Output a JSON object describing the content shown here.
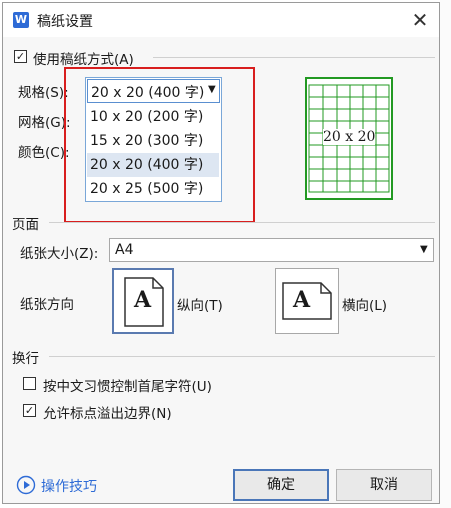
{
  "dialog": {
    "title": "稿纸设置",
    "close_glyph": "✕",
    "use_checkbox_label": "使用稿纸方式(A)",
    "spec_label": "规格(S):",
    "grid_label": "网格(G):",
    "color_label": "颜色(C):",
    "spec_selected": "20 x 20 (400 字)",
    "spec_options": [
      "10 x 20 (200 字)",
      "15 x 20 (300 字)",
      "20 x 20 (400 字)",
      "20 x 25 (500 字)"
    ],
    "preview_label": "20 x 20",
    "page_section": "页面",
    "paper_size_label": "纸张大小(Z):",
    "paper_size_value": "A4",
    "orientation_label": "纸张方向",
    "portrait_label": "纵向(T)",
    "landscape_label": "横向(L)",
    "orientation_glyph": "A",
    "wrap_section": "换行",
    "wrap_option1": "按中文习惯控制首尾字符(U)",
    "wrap_option2": "允许标点溢出边界(N)",
    "tips_link": "操作技巧",
    "ok_button": "确定",
    "cancel_button": "取消"
  },
  "colors": {
    "accent": "#2e6bd6",
    "highlight_box": "#d81e1e",
    "grid_green": "#229922"
  },
  "icons": {
    "app": "wps-writer-icon",
    "close": "close-icon",
    "dropdown": "chevron-down-icon",
    "tips": "play-circle-icon"
  }
}
